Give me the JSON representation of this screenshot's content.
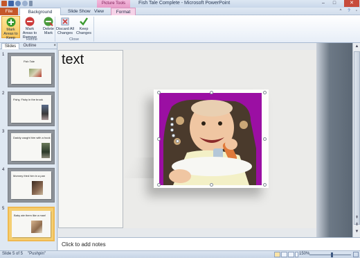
{
  "window": {
    "title": "Fish Tale Complete - Microsoft PowerPoint",
    "contextual_group": "Picture Tools",
    "minimize_icon": "minimize-icon",
    "maximize_icon": "maximize-icon",
    "close_icon": "close-icon"
  },
  "tabs": {
    "file": "File",
    "background_removal": "Background Removal",
    "slide_show": "Slide Show",
    "view": "View",
    "format": "Format"
  },
  "ribbon": {
    "buttons": {
      "mark_keep": "Mark Areas to Keep",
      "mark_remove": "Mark Areas to Remove",
      "delete_mark": "Delete Mark",
      "discard": "Discard All Changes",
      "keep_changes": "Keep Changes"
    },
    "groups": {
      "refine": "Refine",
      "close": "Close"
    }
  },
  "left_pane": {
    "tabs": {
      "slides": "Slides",
      "outline": "Outline"
    },
    "close_glyph": "×",
    "slides": [
      {
        "number": "1",
        "caption": "Fish Tale",
        "selected": false
      },
      {
        "number": "2",
        "caption": "Fishy, Fishy in the brook",
        "selected": false
      },
      {
        "number": "3",
        "caption": "Daddy caught him with a hook",
        "selected": false
      },
      {
        "number": "4",
        "caption": "Mommy fried him in a pan",
        "selected": false
      },
      {
        "number": "5",
        "caption": "Baby ate them like a man!",
        "selected": true
      }
    ]
  },
  "slide": {
    "placeholder_text": "text"
  },
  "notes": {
    "placeholder": "Click to add notes"
  },
  "status": {
    "slide_info": "Slide 5 of 5",
    "theme": "\"Pushpin\"",
    "zoom": "150%",
    "zoom_level": 0.55
  },
  "colors": {
    "file_tab": "#c5582a",
    "picture_tools": "#e89bc8",
    "removal_mask": "#9b0fa3",
    "selected_thumb": "#f5cf72"
  }
}
